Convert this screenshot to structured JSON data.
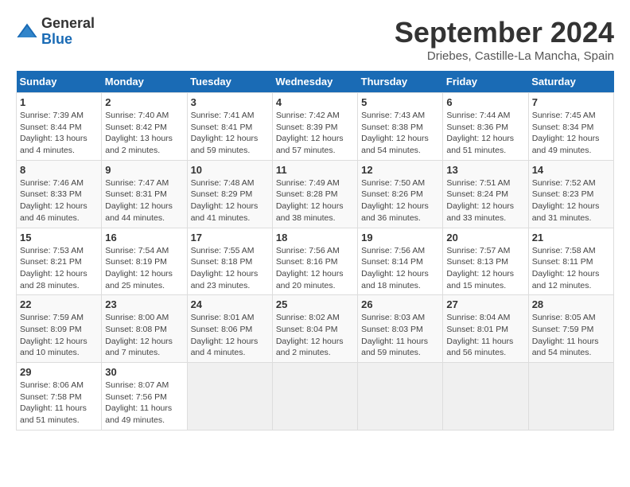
{
  "header": {
    "logo_general": "General",
    "logo_blue": "Blue",
    "month_title": "September 2024",
    "location": "Driebes, Castille-La Mancha, Spain"
  },
  "days_of_week": [
    "Sunday",
    "Monday",
    "Tuesday",
    "Wednesday",
    "Thursday",
    "Friday",
    "Saturday"
  ],
  "weeks": [
    [
      {
        "day": "1",
        "sunrise": "Sunrise: 7:39 AM",
        "sunset": "Sunset: 8:44 PM",
        "daylight": "Daylight: 13 hours and 4 minutes."
      },
      {
        "day": "2",
        "sunrise": "Sunrise: 7:40 AM",
        "sunset": "Sunset: 8:42 PM",
        "daylight": "Daylight: 13 hours and 2 minutes."
      },
      {
        "day": "3",
        "sunrise": "Sunrise: 7:41 AM",
        "sunset": "Sunset: 8:41 PM",
        "daylight": "Daylight: 12 hours and 59 minutes."
      },
      {
        "day": "4",
        "sunrise": "Sunrise: 7:42 AM",
        "sunset": "Sunset: 8:39 PM",
        "daylight": "Daylight: 12 hours and 57 minutes."
      },
      {
        "day": "5",
        "sunrise": "Sunrise: 7:43 AM",
        "sunset": "Sunset: 8:38 PM",
        "daylight": "Daylight: 12 hours and 54 minutes."
      },
      {
        "day": "6",
        "sunrise": "Sunrise: 7:44 AM",
        "sunset": "Sunset: 8:36 PM",
        "daylight": "Daylight: 12 hours and 51 minutes."
      },
      {
        "day": "7",
        "sunrise": "Sunrise: 7:45 AM",
        "sunset": "Sunset: 8:34 PM",
        "daylight": "Daylight: 12 hours and 49 minutes."
      }
    ],
    [
      {
        "day": "8",
        "sunrise": "Sunrise: 7:46 AM",
        "sunset": "Sunset: 8:33 PM",
        "daylight": "Daylight: 12 hours and 46 minutes."
      },
      {
        "day": "9",
        "sunrise": "Sunrise: 7:47 AM",
        "sunset": "Sunset: 8:31 PM",
        "daylight": "Daylight: 12 hours and 44 minutes."
      },
      {
        "day": "10",
        "sunrise": "Sunrise: 7:48 AM",
        "sunset": "Sunset: 8:29 PM",
        "daylight": "Daylight: 12 hours and 41 minutes."
      },
      {
        "day": "11",
        "sunrise": "Sunrise: 7:49 AM",
        "sunset": "Sunset: 8:28 PM",
        "daylight": "Daylight: 12 hours and 38 minutes."
      },
      {
        "day": "12",
        "sunrise": "Sunrise: 7:50 AM",
        "sunset": "Sunset: 8:26 PM",
        "daylight": "Daylight: 12 hours and 36 minutes."
      },
      {
        "day": "13",
        "sunrise": "Sunrise: 7:51 AM",
        "sunset": "Sunset: 8:24 PM",
        "daylight": "Daylight: 12 hours and 33 minutes."
      },
      {
        "day": "14",
        "sunrise": "Sunrise: 7:52 AM",
        "sunset": "Sunset: 8:23 PM",
        "daylight": "Daylight: 12 hours and 31 minutes."
      }
    ],
    [
      {
        "day": "15",
        "sunrise": "Sunrise: 7:53 AM",
        "sunset": "Sunset: 8:21 PM",
        "daylight": "Daylight: 12 hours and 28 minutes."
      },
      {
        "day": "16",
        "sunrise": "Sunrise: 7:54 AM",
        "sunset": "Sunset: 8:19 PM",
        "daylight": "Daylight: 12 hours and 25 minutes."
      },
      {
        "day": "17",
        "sunrise": "Sunrise: 7:55 AM",
        "sunset": "Sunset: 8:18 PM",
        "daylight": "Daylight: 12 hours and 23 minutes."
      },
      {
        "day": "18",
        "sunrise": "Sunrise: 7:56 AM",
        "sunset": "Sunset: 8:16 PM",
        "daylight": "Daylight: 12 hours and 20 minutes."
      },
      {
        "day": "19",
        "sunrise": "Sunrise: 7:56 AM",
        "sunset": "Sunset: 8:14 PM",
        "daylight": "Daylight: 12 hours and 18 minutes."
      },
      {
        "day": "20",
        "sunrise": "Sunrise: 7:57 AM",
        "sunset": "Sunset: 8:13 PM",
        "daylight": "Daylight: 12 hours and 15 minutes."
      },
      {
        "day": "21",
        "sunrise": "Sunrise: 7:58 AM",
        "sunset": "Sunset: 8:11 PM",
        "daylight": "Daylight: 12 hours and 12 minutes."
      }
    ],
    [
      {
        "day": "22",
        "sunrise": "Sunrise: 7:59 AM",
        "sunset": "Sunset: 8:09 PM",
        "daylight": "Daylight: 12 hours and 10 minutes."
      },
      {
        "day": "23",
        "sunrise": "Sunrise: 8:00 AM",
        "sunset": "Sunset: 8:08 PM",
        "daylight": "Daylight: 12 hours and 7 minutes."
      },
      {
        "day": "24",
        "sunrise": "Sunrise: 8:01 AM",
        "sunset": "Sunset: 8:06 PM",
        "daylight": "Daylight: 12 hours and 4 minutes."
      },
      {
        "day": "25",
        "sunrise": "Sunrise: 8:02 AM",
        "sunset": "Sunset: 8:04 PM",
        "daylight": "Daylight: 12 hours and 2 minutes."
      },
      {
        "day": "26",
        "sunrise": "Sunrise: 8:03 AM",
        "sunset": "Sunset: 8:03 PM",
        "daylight": "Daylight: 11 hours and 59 minutes."
      },
      {
        "day": "27",
        "sunrise": "Sunrise: 8:04 AM",
        "sunset": "Sunset: 8:01 PM",
        "daylight": "Daylight: 11 hours and 56 minutes."
      },
      {
        "day": "28",
        "sunrise": "Sunrise: 8:05 AM",
        "sunset": "Sunset: 7:59 PM",
        "daylight": "Daylight: 11 hours and 54 minutes."
      }
    ],
    [
      {
        "day": "29",
        "sunrise": "Sunrise: 8:06 AM",
        "sunset": "Sunset: 7:58 PM",
        "daylight": "Daylight: 11 hours and 51 minutes."
      },
      {
        "day": "30",
        "sunrise": "Sunrise: 8:07 AM",
        "sunset": "Sunset: 7:56 PM",
        "daylight": "Daylight: 11 hours and 49 minutes."
      },
      null,
      null,
      null,
      null,
      null
    ]
  ]
}
